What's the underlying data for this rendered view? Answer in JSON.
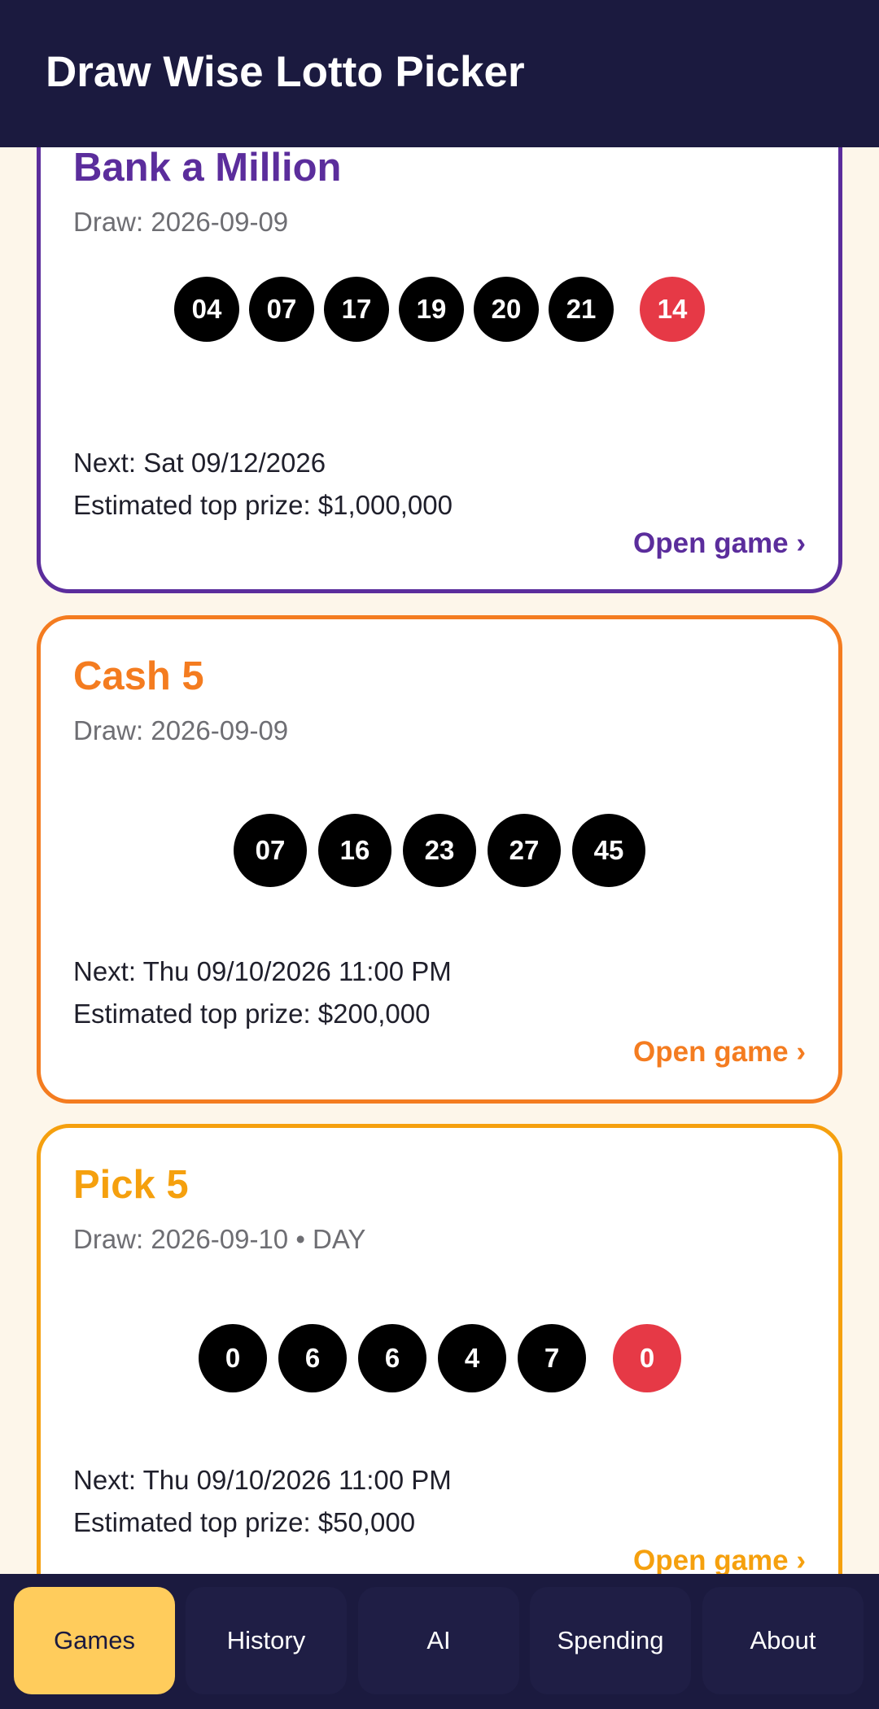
{
  "app": {
    "title": "Draw Wise Lotto Picker"
  },
  "colors": {
    "header_bg": "#1b1a3f",
    "page_bg": "#fdf6ea",
    "bank_accent": "#5b2d9c",
    "cash5_accent": "#f47c20",
    "pick5_accent": "#f5a00e",
    "bonus_ball": "#e63946",
    "nav_active": "#ffcc5c"
  },
  "cards": [
    {
      "title": "Bank a Million",
      "draw": "Draw: 2026-09-09",
      "numbers": [
        "04",
        "07",
        "17",
        "19",
        "20",
        "21"
      ],
      "bonus": "14",
      "next": "Next: Sat 09/12/2026",
      "prize": "Estimated top prize: $1,000,000",
      "link": "Open game ›"
    },
    {
      "title": "Cash 5",
      "draw": "Draw: 2026-09-09",
      "numbers": [
        "07",
        "16",
        "23",
        "27",
        "45"
      ],
      "next": "Next: Thu 09/10/2026 11:00 PM",
      "prize": "Estimated top prize: $200,000",
      "link": "Open game ›"
    },
    {
      "title": "Pick 5",
      "draw": "Draw: 2026-09-10 • DAY",
      "numbers": [
        "0",
        "6",
        "6",
        "4",
        "7"
      ],
      "bonus": "0",
      "next": "Next: Thu 09/10/2026 11:00 PM",
      "prize": "Estimated top prize: $50,000",
      "link": "Open game ›"
    }
  ],
  "nav": {
    "items": [
      "Games",
      "History",
      "AI",
      "Spending",
      "About"
    ],
    "active": "Games"
  }
}
